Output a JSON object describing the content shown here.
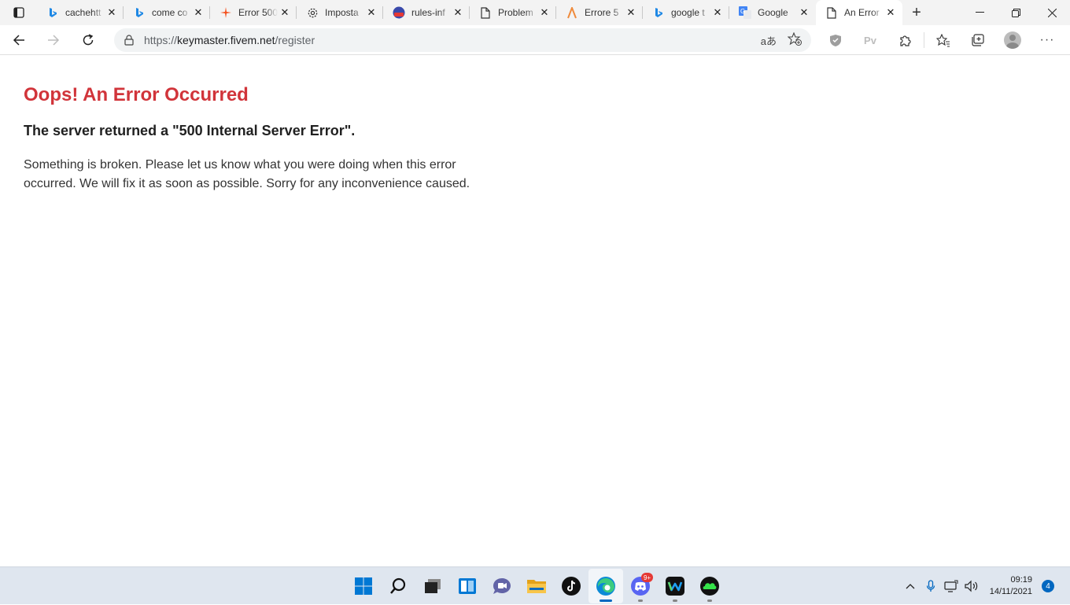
{
  "browser": {
    "tabs": [
      {
        "title": "cachehtt",
        "icon": "bing-icon",
        "active": false
      },
      {
        "title": "come co",
        "icon": "bing-icon",
        "active": false
      },
      {
        "title": "Error 500",
        "icon": "spark-icon",
        "active": false
      },
      {
        "title": "Imposta",
        "icon": "gear-icon",
        "active": false
      },
      {
        "title": "rules-inf",
        "icon": "badge-icon",
        "active": false
      },
      {
        "title": "Problem",
        "icon": "page-icon",
        "active": false
      },
      {
        "title": "Errore 5",
        "icon": "lambda-icon",
        "active": false
      },
      {
        "title": "google t",
        "icon": "bing-icon",
        "active": false
      },
      {
        "title": "Google",
        "icon": "google-translate-icon",
        "active": false
      },
      {
        "title": "An Error",
        "icon": "page-icon",
        "active": true
      }
    ],
    "address": {
      "prefix": "https://",
      "host": "keymaster.fivem.net",
      "path": "/register"
    },
    "toolbar": {
      "read_aloud": "aあ",
      "pv_label": "Pv"
    }
  },
  "page": {
    "title": "Oops! An Error Occurred",
    "subtitle": "The server returned a \"500 Internal Server Error\".",
    "body": "Something is broken. Please let us know what you were doing when this error occurred. We will fix it as soon as possible. Sorry for any inconvenience caused."
  },
  "taskbar": {
    "apps": [
      {
        "name": "start-button",
        "icon": "windows-icon"
      },
      {
        "name": "search-button",
        "icon": "search-icon"
      },
      {
        "name": "task-view-button",
        "icon": "task-view-icon"
      },
      {
        "name": "widgets-button",
        "icon": "widgets-icon"
      },
      {
        "name": "chat-button",
        "icon": "chat-icon"
      },
      {
        "name": "file-explorer-button",
        "icon": "folder-icon"
      },
      {
        "name": "tiktok-button",
        "icon": "tiktok-icon"
      },
      {
        "name": "edge-button",
        "icon": "edge-icon"
      },
      {
        "name": "discord-button",
        "icon": "discord-icon",
        "badge": "9+"
      },
      {
        "name": "webex-button",
        "icon": "webex-icon"
      },
      {
        "name": "cloud-app-button",
        "icon": "cloud-icon"
      }
    ],
    "clock": {
      "time": "09:19",
      "date": "14/11/2021"
    },
    "notification_count": "4"
  }
}
